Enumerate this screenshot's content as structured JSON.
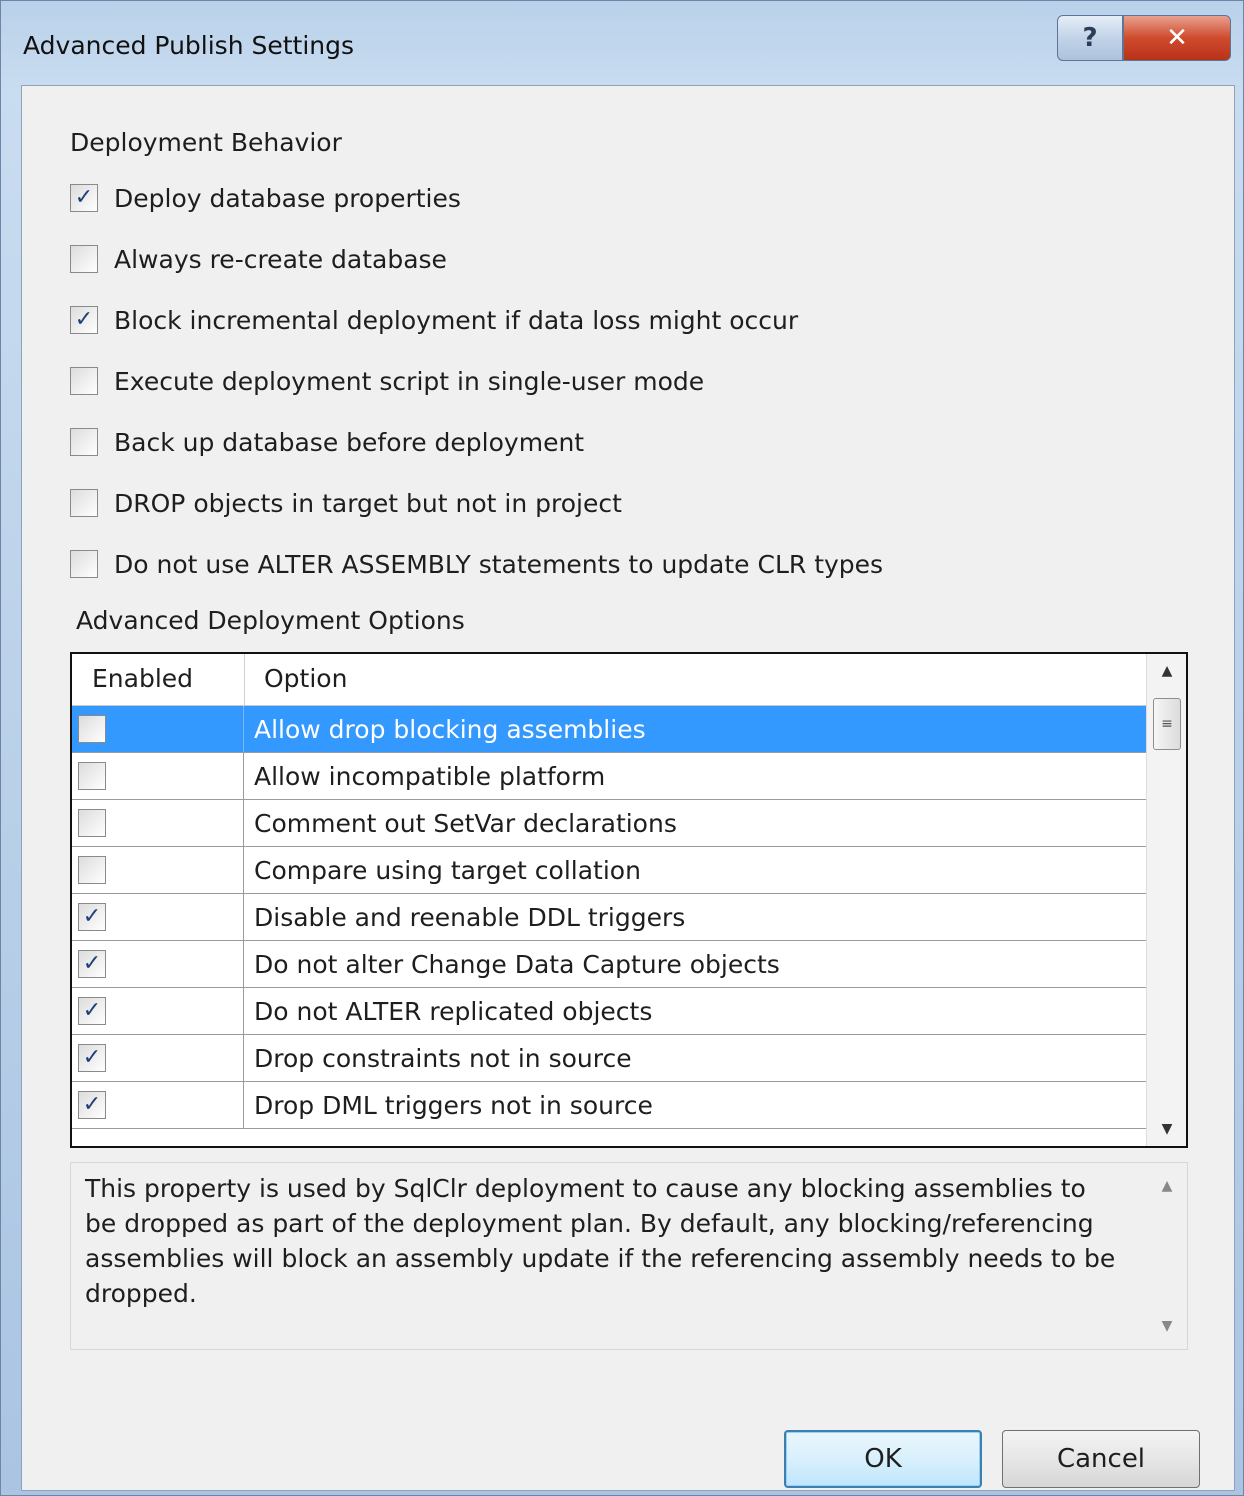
{
  "window": {
    "title": "Advanced Publish Settings",
    "help_glyph": "?",
    "close_glyph": "✕"
  },
  "deployment_behavior": {
    "label": "Deployment Behavior",
    "options": [
      {
        "label": "Deploy database properties",
        "checked": true
      },
      {
        "label": "Always re-create database",
        "checked": false
      },
      {
        "label": "Block incremental deployment if data loss might occur",
        "checked": true
      },
      {
        "label": "Execute deployment script in single-user mode",
        "checked": false
      },
      {
        "label": "Back up database before deployment",
        "checked": false
      },
      {
        "label": "DROP objects in target but not in project",
        "checked": false
      },
      {
        "label": "Do not use ALTER ASSEMBLY statements to update CLR types",
        "checked": false
      }
    ]
  },
  "advanced_options": {
    "label": "Advanced Deployment Options",
    "columns": [
      "Enabled",
      "Option"
    ],
    "rows": [
      {
        "option": "Allow drop blocking assemblies",
        "enabled": false,
        "selected": true
      },
      {
        "option": "Allow incompatible platform",
        "enabled": false,
        "selected": false
      },
      {
        "option": "Comment out SetVar declarations",
        "enabled": false,
        "selected": false
      },
      {
        "option": "Compare using target collation",
        "enabled": false,
        "selected": false
      },
      {
        "option": "Disable and reenable DDL triggers",
        "enabled": true,
        "selected": false
      },
      {
        "option": "Do not alter Change Data Capture objects",
        "enabled": true,
        "selected": false
      },
      {
        "option": "Do not ALTER replicated objects",
        "enabled": true,
        "selected": false
      },
      {
        "option": "Drop constraints not in source",
        "enabled": true,
        "selected": false
      },
      {
        "option": "Drop DML triggers not in source",
        "enabled": true,
        "selected": false
      }
    ]
  },
  "description": "This property is used by SqlClr deployment to cause any blocking assemblies to be dropped as part of the deployment plan. By default, any blocking/referencing assemblies will block an assembly update if the referencing assembly needs to be dropped.",
  "buttons": {
    "ok": "OK",
    "cancel": "Cancel"
  },
  "icons": {
    "check": "✓",
    "scroll_up": "▲",
    "scroll_down": "▼",
    "grip": "≡"
  },
  "colors": {
    "selection": "#3399ff",
    "title_gradient": "#b9d1ea",
    "close_button": "#cf4b2d"
  }
}
